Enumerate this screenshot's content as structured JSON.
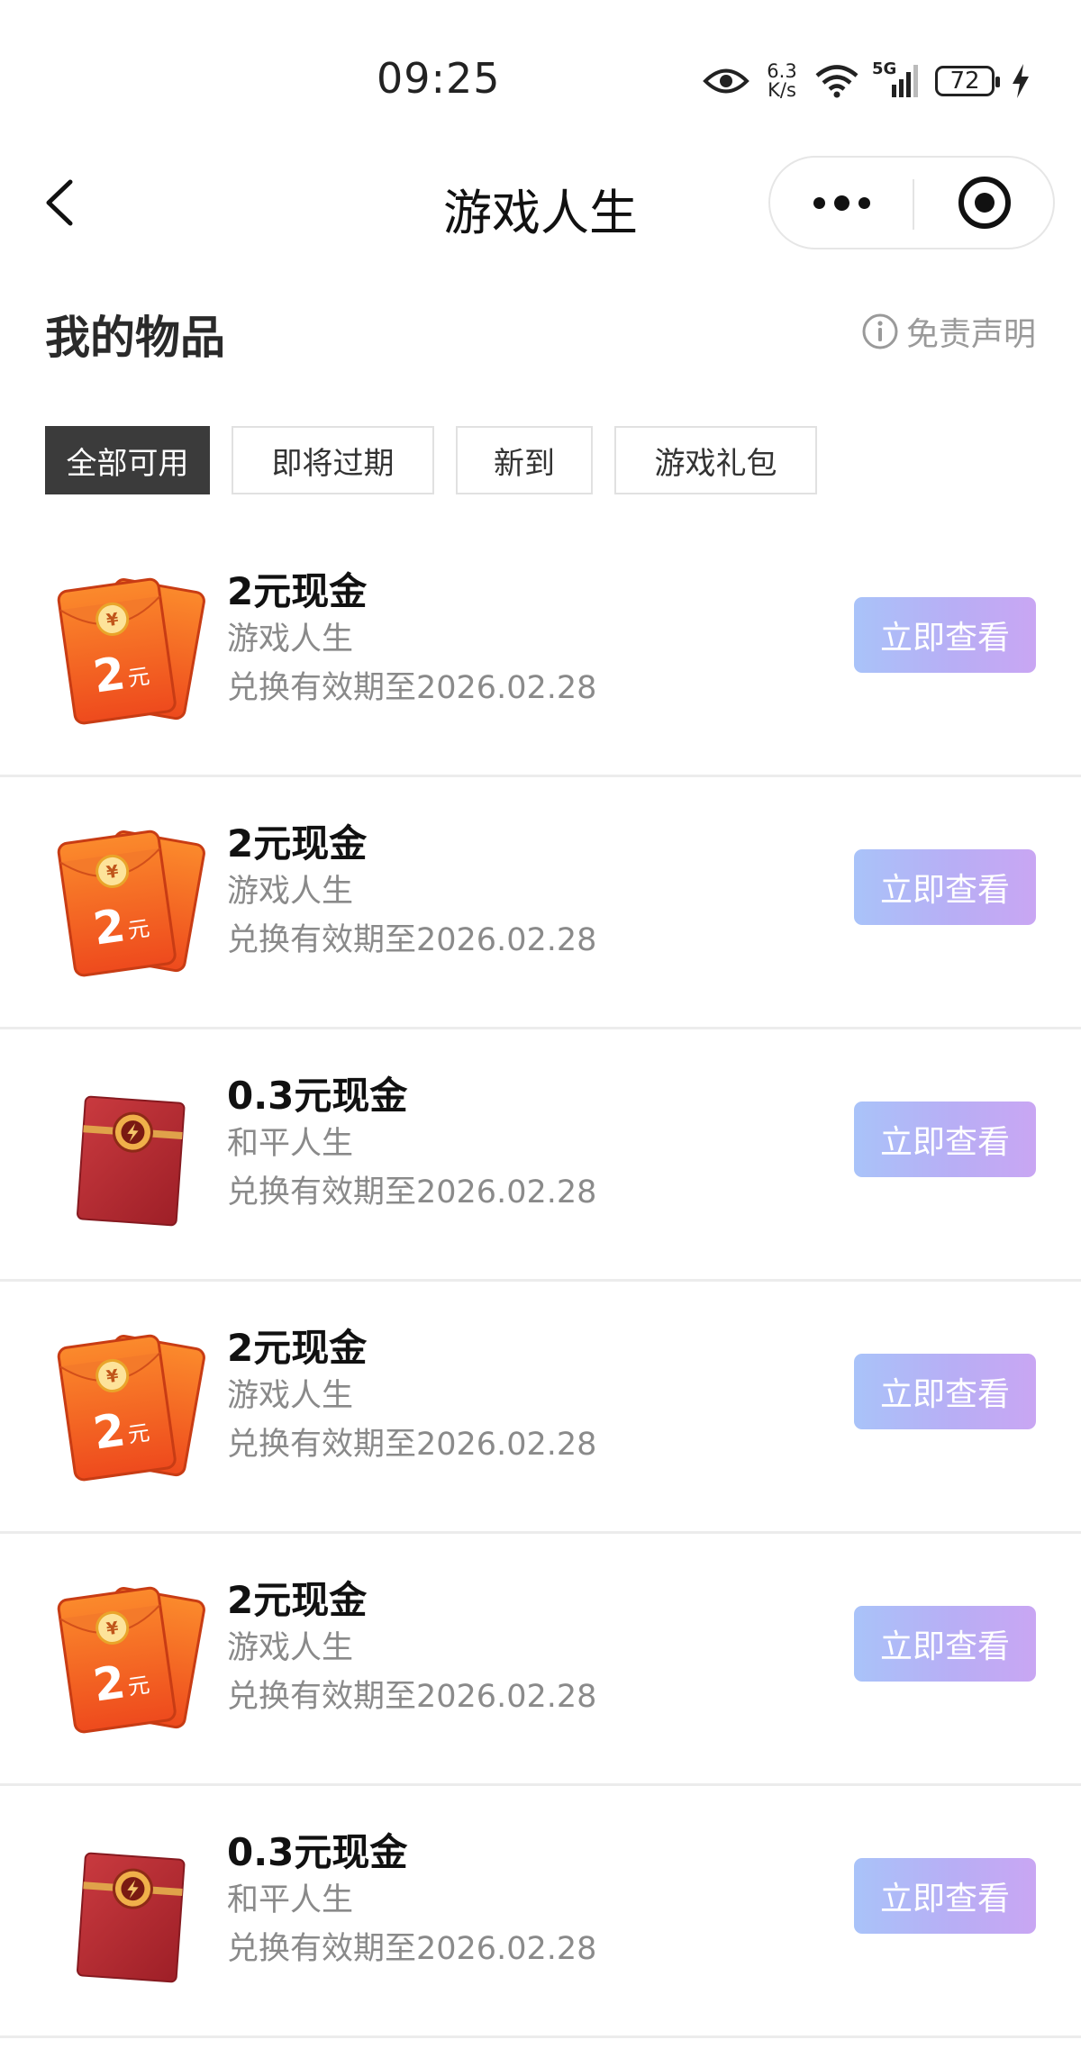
{
  "status_bar": {
    "time": "09:25",
    "net_speed_value": "6.3",
    "net_speed_unit": "K/s",
    "network_type": "5G",
    "battery": "72",
    "icons": [
      "eye-icon",
      "wifi-icon",
      "signal-icon",
      "battery-icon",
      "charging-icon"
    ]
  },
  "nav": {
    "title": "游戏人生",
    "back_icon": "chevron-left-icon",
    "more_icon": "more-dots-icon",
    "close_icon": "target-circle-icon"
  },
  "header": {
    "title": "我的物品",
    "disclaimer": "免责声明",
    "disclaimer_icon": "info-icon"
  },
  "tabs": [
    {
      "label": "全部可用",
      "active": true
    },
    {
      "label": "即将过期",
      "active": false
    },
    {
      "label": "新到",
      "active": false
    },
    {
      "label": "游戏礼包",
      "active": false
    }
  ],
  "items": [
    {
      "title": "2元现金",
      "source": "游戏人生",
      "expiry": "兑换有效期至2026.02.28",
      "button": "立即查看",
      "icon": "orange-red-envelope-icon",
      "icon_label": "2",
      "icon_unit": "元"
    },
    {
      "title": "2元现金",
      "source": "游戏人生",
      "expiry": "兑换有效期至2026.02.28",
      "button": "立即查看",
      "icon": "orange-red-envelope-icon",
      "icon_label": "2",
      "icon_unit": "元"
    },
    {
      "title": "0.3元现金",
      "source": "和平人生",
      "expiry": "兑换有效期至2026.02.28",
      "button": "立即查看",
      "icon": "red-envelope-icon"
    },
    {
      "title": "2元现金",
      "source": "游戏人生",
      "expiry": "兑换有效期至2026.02.28",
      "button": "立即查看",
      "icon": "orange-red-envelope-icon",
      "icon_label": "2",
      "icon_unit": "元"
    },
    {
      "title": "2元现金",
      "source": "游戏人生",
      "expiry": "兑换有效期至2026.02.28",
      "button": "立即查看",
      "icon": "orange-red-envelope-icon",
      "icon_label": "2",
      "icon_unit": "元"
    },
    {
      "title": "0.3元现金",
      "source": "和平人生",
      "expiry": "兑换有效期至2026.02.28",
      "button": "立即查看",
      "icon": "red-envelope-icon"
    }
  ],
  "colors": {
    "accent_button_start": "#a9c3f9",
    "accent_button_end": "#c9a6f3",
    "active_tab": "#3b3b3b",
    "envelope_orange": "#f0561f",
    "envelope_red": "#b6262e"
  }
}
